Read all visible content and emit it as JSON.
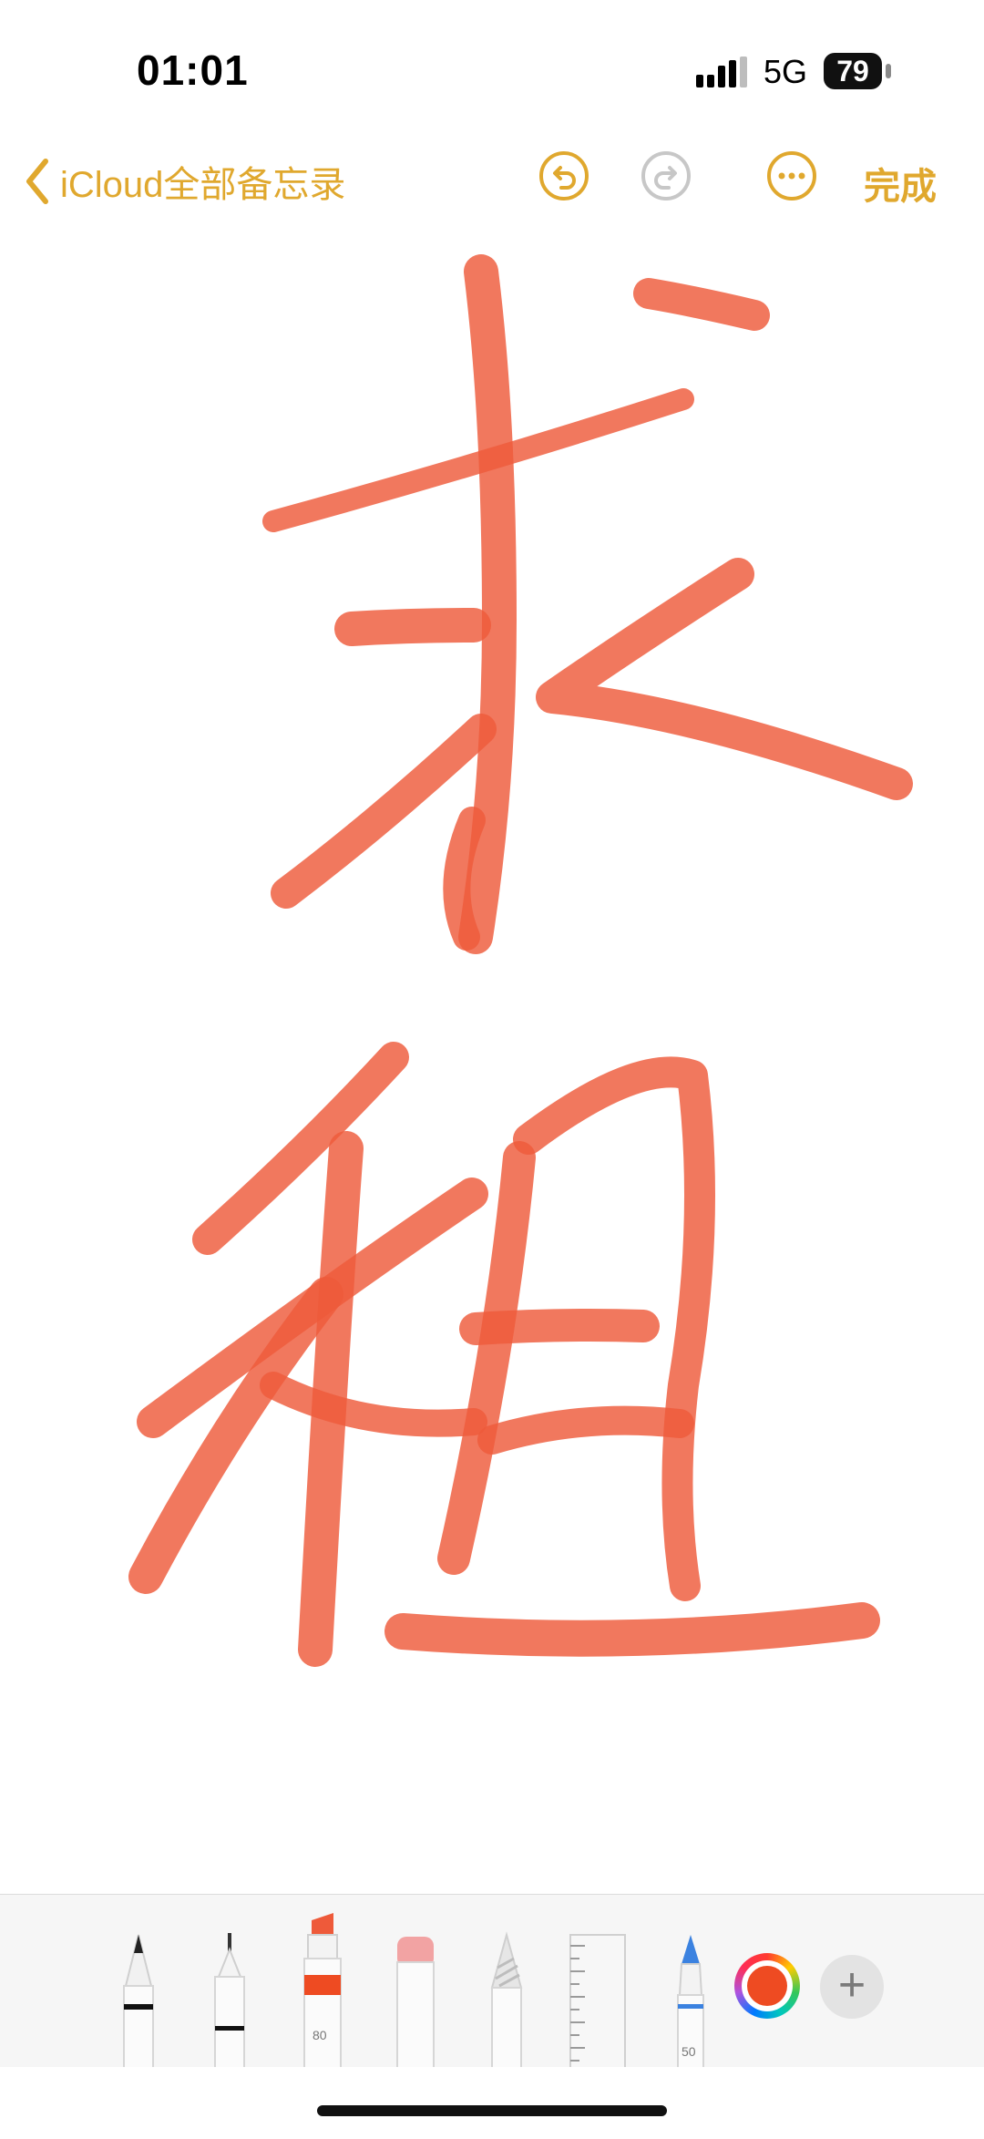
{
  "status_bar": {
    "time": "01:01",
    "network": "5G",
    "battery": "79"
  },
  "nav": {
    "back_label": "iCloud全部备忘录",
    "done_label": "完成"
  },
  "canvas": {
    "handwriting": "求租",
    "ink_color": "#EE5A3A"
  },
  "toolbar": {
    "marker_width_label": "80",
    "crayon_width_label": "50",
    "tools": [
      "pen-icon",
      "fineliner-icon",
      "marker-icon",
      "eraser-icon",
      "pencil-icon",
      "ruler-icon",
      "crayon-icon"
    ],
    "selected_color": "#EE4B22",
    "accent_color": "#E0A82E"
  }
}
